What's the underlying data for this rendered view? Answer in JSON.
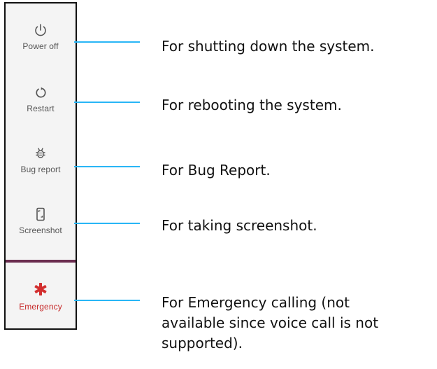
{
  "power_menu": {
    "items": [
      {
        "label": "Power off",
        "icon": "power-icon"
      },
      {
        "label": "Restart",
        "icon": "restart-icon"
      },
      {
        "label": "Bug report",
        "icon": "bug-icon"
      },
      {
        "label": "Screenshot",
        "icon": "screenshot-icon"
      }
    ],
    "emergency": {
      "label": "Emergency",
      "icon": "emergency-asterisk-icon"
    }
  },
  "descriptions": [
    "For shutting down the system.",
    "For rebooting the system.",
    "For Bug Report.",
    "For taking screenshot.",
    "For Emergency calling (not",
    "available since voice call is not",
    "supported)."
  ],
  "colors": {
    "panel_bg": "#f4f4f4",
    "panel_border": "#111111",
    "divider": "#6b2d4f",
    "connector": "#29b6f6",
    "emergency": "#d32f2f",
    "icon": "#555555"
  }
}
